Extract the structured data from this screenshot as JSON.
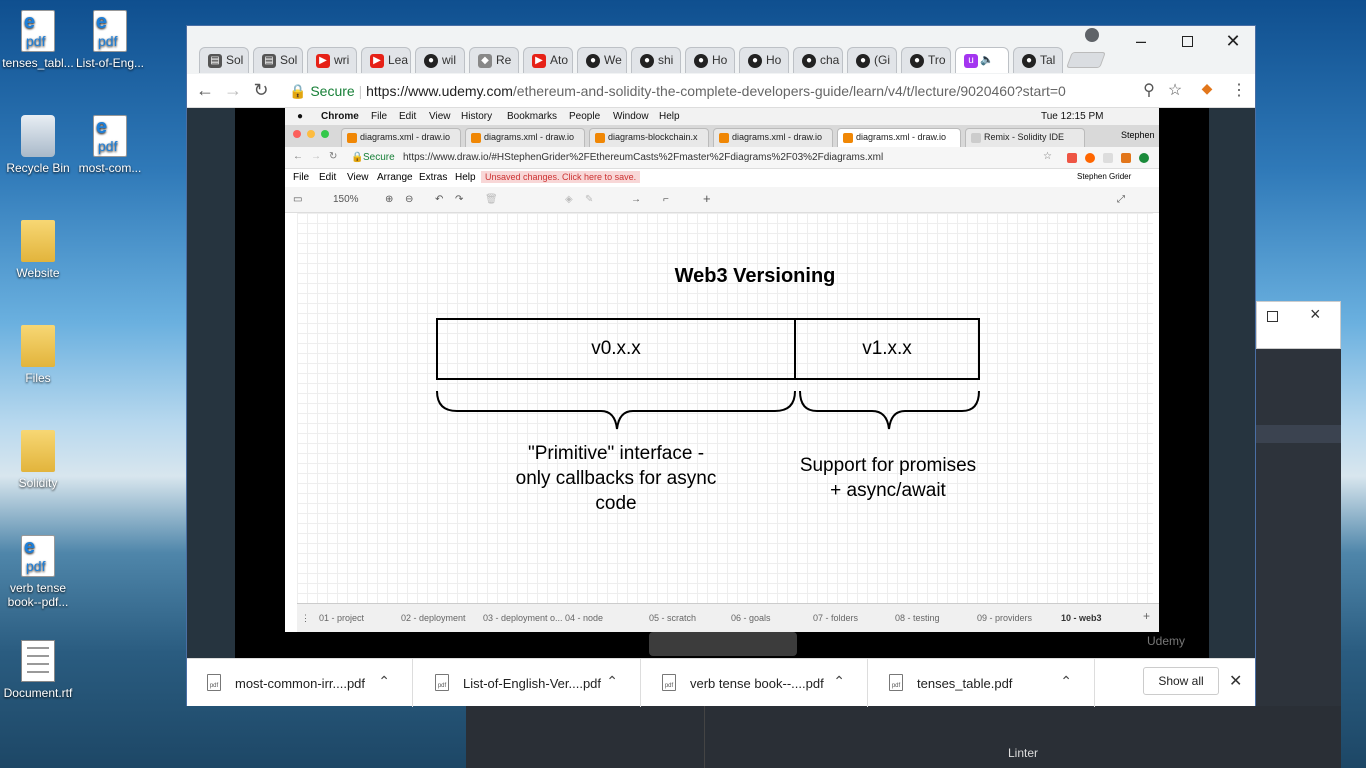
{
  "desktop": {
    "icons": [
      {
        "label": "tenses_tabl...",
        "type": "pdf"
      },
      {
        "label": "List-of-Eng...",
        "type": "pdf"
      },
      {
        "label": "Recycle Bin",
        "type": "recycle"
      },
      {
        "label": "most-com...",
        "type": "pdf"
      },
      {
        "label": "Website",
        "type": "folder"
      },
      {
        "label": "Files",
        "type": "folder"
      },
      {
        "label": "Solidity",
        "type": "folder"
      },
      {
        "label": "verb tense book--pdf...",
        "type": "pdf"
      },
      {
        "label": "Document.rtf",
        "type": "doc"
      }
    ],
    "pdf_badge": "pdf",
    "edge_letter": "e"
  },
  "browser": {
    "tabs": [
      {
        "label": "Sol",
        "icon": "book-icon",
        "color": "#555"
      },
      {
        "label": "Sol",
        "icon": "book-icon",
        "color": "#555"
      },
      {
        "label": "wri",
        "icon": "youtube-icon",
        "color": "#e62117"
      },
      {
        "label": "Lea",
        "icon": "youtube-icon",
        "color": "#e62117"
      },
      {
        "label": "wil",
        "icon": "github-icon",
        "color": "#222"
      },
      {
        "label": "Re",
        "icon": "ethereum-icon",
        "color": "#666"
      },
      {
        "label": "Ato",
        "icon": "youtube-icon",
        "color": "#e62117"
      },
      {
        "label": "We",
        "icon": "github-icon",
        "color": "#222"
      },
      {
        "label": "shi",
        "icon": "github-icon",
        "color": "#222"
      },
      {
        "label": "Ho",
        "icon": "github-icon",
        "color": "#222"
      },
      {
        "label": "Ho",
        "icon": "github-icon",
        "color": "#222"
      },
      {
        "label": "cha",
        "icon": "github-icon",
        "color": "#222"
      },
      {
        "label": "(Gi",
        "icon": "github-icon",
        "color": "#222"
      },
      {
        "label": "Tro",
        "icon": "github-icon",
        "color": "#222"
      },
      {
        "label": "",
        "icon": "udemy-icon",
        "color": "#a435f0"
      },
      {
        "label": "Tal",
        "icon": "github-icon",
        "color": "#222"
      }
    ],
    "secure_label": "Secure",
    "url_host": "https://www.udemy.com",
    "url_path": "/ethereum-and-solidity-the-complete-developers-guide/learn/v4/t/lecture/9020460?start=0"
  },
  "mac": {
    "menu": [
      "Chrome",
      "File",
      "Edit",
      "View",
      "History",
      "Bookmarks",
      "People",
      "Window",
      "Help"
    ],
    "clock": "Tue 12:15 PM",
    "tabs": [
      "diagrams.xml - draw.io",
      "diagrams.xml - draw.io",
      "diagrams-blockchain.x",
      "diagrams.xml - draw.io",
      "diagrams.xml - draw.io",
      "Remix - Solidity IDE"
    ],
    "profile": "Stephen",
    "secure_label": "Secure",
    "url": "https://www.draw.io/#HStephenGrider%2FEthereumCasts%2Fmaster%2Fdiagrams%2F03%2Fdiagrams.xml",
    "drawio_menu": [
      "File",
      "Edit",
      "View",
      "Arrange",
      "Extras",
      "Help"
    ],
    "unsaved": "Unsaved changes. Click here to save.",
    "user": "Stephen Grider",
    "zoom": "150%",
    "diagram": {
      "title": "Web3 Versioning",
      "box1": "v0.x.x",
      "box2": "v1.x.x",
      "note1_line1": "\"Primitive\" interface -",
      "note1_line2": "only callbacks for async",
      "note1_line3": "code",
      "note2_line1": "Support for promises",
      "note2_line2": "+ async/await"
    },
    "pages": [
      "01 - project",
      "02 - deployment",
      "03 - deployment o...",
      "04 - node",
      "05 - scratch",
      "06 - goals",
      "07 - folders",
      "08 - testing",
      "09 - providers",
      "10 - web3"
    ],
    "watermark": "Udemy"
  },
  "downloads": [
    {
      "name": "most-common-irr....pdf"
    },
    {
      "name": "List-of-English-Ver....pdf"
    },
    {
      "name": "verb tense book--....pdf"
    },
    {
      "name": "tenses_table.pdf"
    }
  ],
  "show_all": "Show all",
  "bg_app": {
    "status": "Linter"
  }
}
